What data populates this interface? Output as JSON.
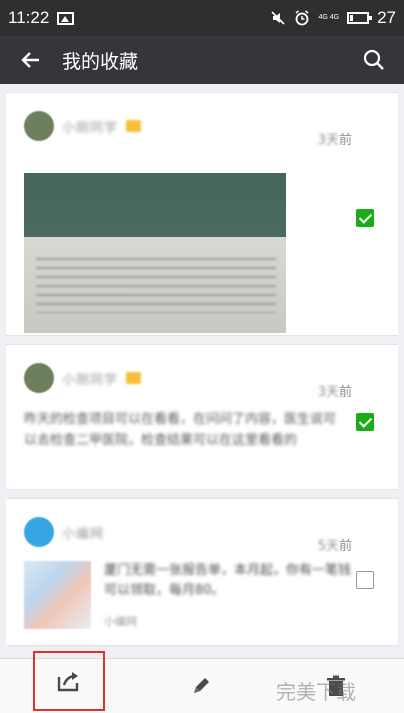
{
  "status_bar": {
    "time": "11:22",
    "network_label": "4G 4G",
    "battery_level": "27"
  },
  "app_bar": {
    "title": "我的收藏",
    "back_icon": "back-arrow-icon",
    "search_icon": "search-icon"
  },
  "favorites": [
    {
      "sender": "小刚同学",
      "time_suffix": "前",
      "selected": true,
      "type": "image"
    },
    {
      "sender": "小刚同学",
      "time_suffix": "前",
      "selected": true,
      "type": "text",
      "text": "昨天的检查项目可以在看看，在问问了内容，医生说可以去检查二甲医院，检查结果可以在这里看看的"
    },
    {
      "sender": "小编网",
      "time_suffix": "前",
      "selected": false,
      "type": "link",
      "text": "厦门无需一张报告单，本月起，你有一笔钱可以领取，每月80。",
      "sub": "小编网"
    }
  ],
  "bottom_toolbar": {
    "share_icon": "share-icon",
    "edit_icon": "pencil-icon",
    "delete_icon": "trash-icon"
  },
  "watermark": "完美下载",
  "colors": {
    "accent_green": "#1aad19",
    "highlight_red": "#e0312d",
    "app_bar": "#36363a"
  }
}
